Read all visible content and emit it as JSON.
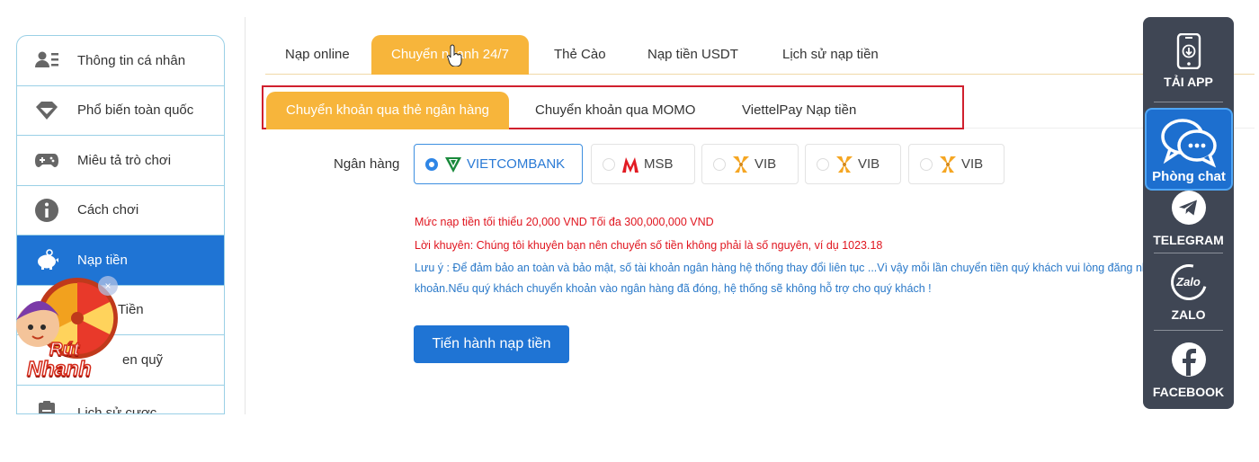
{
  "sidebar": {
    "items": [
      {
        "label": "Thông tin cá nhân",
        "icon": "user-list-icon"
      },
      {
        "label": "Phổ biến toàn quốc",
        "icon": "diamond-icon"
      },
      {
        "label": "Miêu tả trò chơi",
        "icon": "gamepad-icon"
      },
      {
        "label": "Cách chơi",
        "icon": "info-icon"
      },
      {
        "label": "Nạp tiền",
        "icon": "piggy-bank-icon",
        "active": true
      },
      {
        "label": "Tiền",
        "icon": "wallet-icon"
      },
      {
        "label": "en quỹ",
        "icon": "safe-icon"
      },
      {
        "label": "Lịch sử cược",
        "icon": "clipboard-icon"
      }
    ]
  },
  "promo": {
    "line1": "Rút",
    "line2": "Nhanh",
    "close": "×"
  },
  "tabs": {
    "items": [
      "Nạp online",
      "Chuyển nhanh 24/7",
      "Thẻ Cào",
      "Nạp tiền USDT",
      "Lịch sử nạp tiền"
    ],
    "active": "Chuyển nhanh 24/7"
  },
  "subtabs": {
    "items": [
      "Chuyển khoản qua thẻ ngân hàng",
      "Chuyển khoản qua MOMO",
      "ViettelPay Nạp tiền"
    ],
    "active": "Chuyển khoản qua thẻ ngân hàng"
  },
  "bank": {
    "label": "Ngân hàng",
    "options": [
      {
        "name": "VIETCOMBANK",
        "selected": true,
        "color": "#1a8a3c"
      },
      {
        "name": "MSB",
        "selected": false,
        "color": "#e21b23"
      },
      {
        "name": "VIB",
        "selected": false,
        "color": "#f5a623"
      },
      {
        "name": "VIB",
        "selected": false,
        "color": "#f5a623"
      },
      {
        "name": "VIB",
        "selected": false,
        "color": "#f5a623"
      }
    ]
  },
  "notes": {
    "min_max": "Mức nạp tiền tối thiểu 20,000 VND Tối đa 300,000,000 VND",
    "advice": "Lời khuyên: Chúng tôi khuyên bạn nên chuyển số tiền không phải là số nguyên, ví dụ 1023.18",
    "caution_line1": "Lưu ý : Để đảm bảo an toàn và bảo mật, số tài khoản ngân hàng hệ thống thay đổi liên tục ...Vì vậy mỗi lần chuyển tiền quý khách vui lòng đăng nhập vào gar",
    "caution_line2": "khoản.Nếu quý khách chuyển khoản vào ngân hàng đã đóng, hệ thống sẽ không hỗ trợ cho quý khách !"
  },
  "submit_label": "Tiến hành nạp tiền",
  "right_panel": {
    "app": "TẢI APP",
    "chat": "Phòng chat",
    "telegram": "TELEGRAM",
    "zalo": "ZALO",
    "zalo_logo": "Zalo",
    "facebook": "FACEBOOK"
  },
  "colors": {
    "accent_orange": "#f7b53b",
    "primary_blue": "#1f74d4",
    "warning_red": "#e0151f",
    "panel_dark": "#3f4654"
  }
}
